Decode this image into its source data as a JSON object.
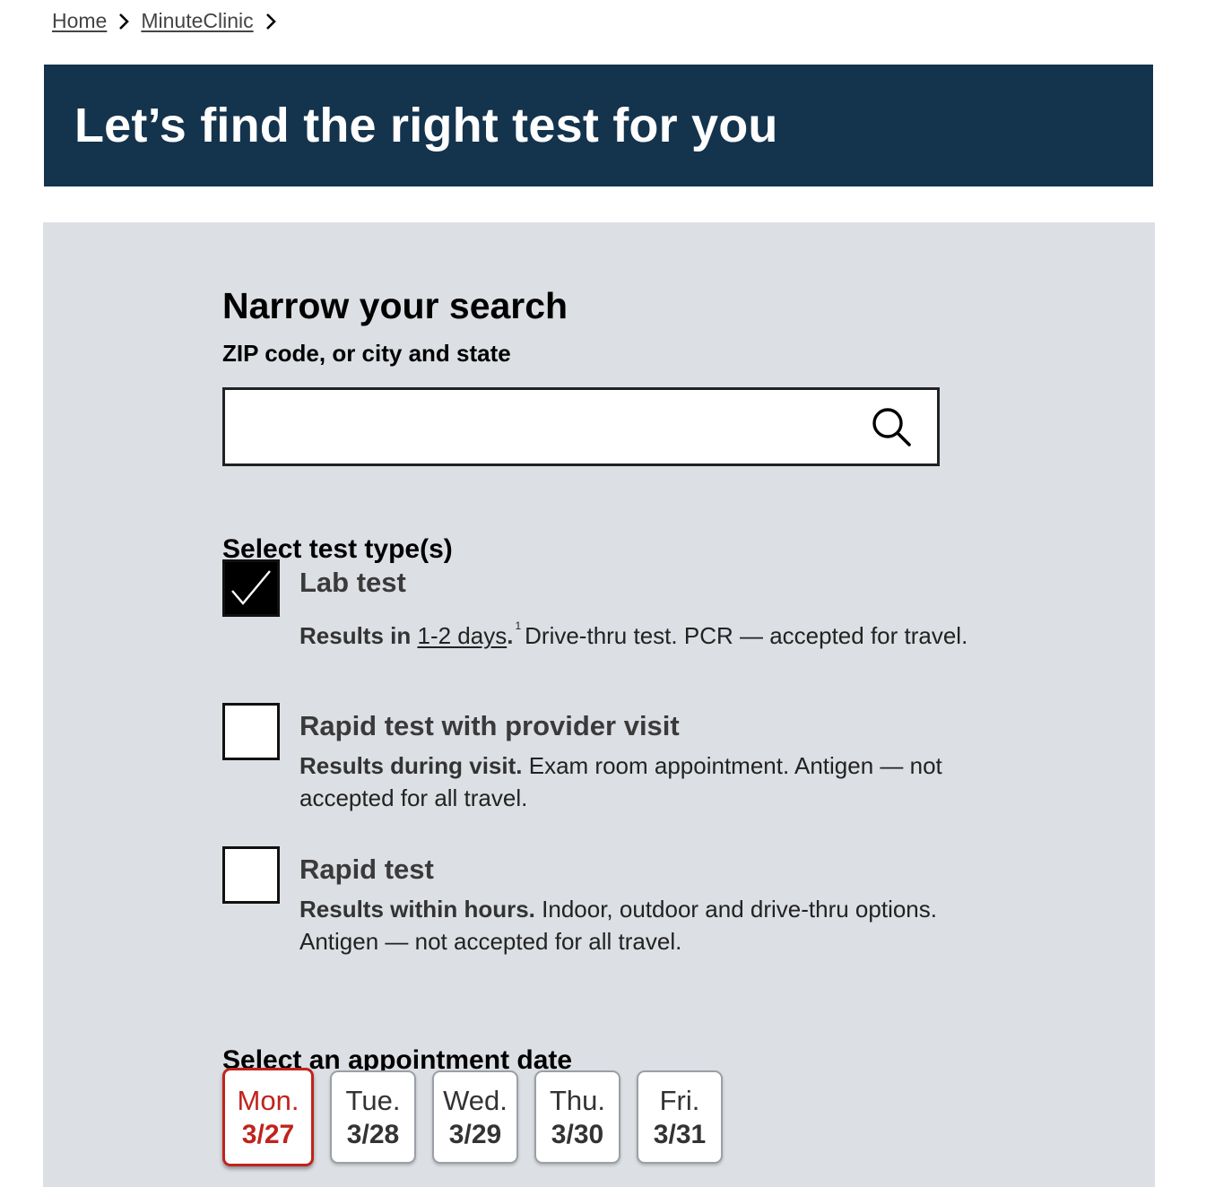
{
  "breadcrumb": {
    "items": [
      {
        "label": "Home"
      },
      {
        "label": "MinuteClinic"
      }
    ]
  },
  "hero": {
    "title": "Let’s find the right test for you"
  },
  "search_panel": {
    "title": "Narrow your search",
    "location_label": "ZIP code, or city and state",
    "location_value": "",
    "location_placeholder": "",
    "test_type_heading": "Select test type(s)",
    "test_types": [
      {
        "title": "Lab test",
        "checked": true,
        "desc_bold": "Results in ",
        "desc_link": "1-2 days",
        "desc_after_link": ".",
        "footnote": "1",
        "desc_rest": "Drive-thru test. PCR — accepted for travel."
      },
      {
        "title": "Rapid test with provider visit",
        "checked": false,
        "desc_bold": "Results during visit.",
        "desc_rest": " Exam room appointment. Antigen — not accepted for all travel."
      },
      {
        "title": "Rapid test",
        "checked": false,
        "desc_bold": "Results within hours.",
        "desc_rest": " Indoor, outdoor and drive-thru options. Antigen — not accepted for all travel."
      }
    ],
    "date_heading": "Select an appointment date",
    "dates": [
      {
        "dow": "Mon.",
        "md": "3/27",
        "selected": true
      },
      {
        "dow": "Tue.",
        "md": "3/28",
        "selected": false
      },
      {
        "dow": "Wed.",
        "md": "3/29",
        "selected": false
      },
      {
        "dow": "Thu.",
        "md": "3/30",
        "selected": false
      },
      {
        "dow": "Fri.",
        "md": "3/31",
        "selected": false
      }
    ]
  },
  "colors": {
    "hero_bg": "#14334d",
    "panel_bg": "#dcdfe3",
    "selected_accent": "#c0231d"
  },
  "icons": [
    "chevron-right-icon",
    "search-icon",
    "checkmark-icon"
  ]
}
